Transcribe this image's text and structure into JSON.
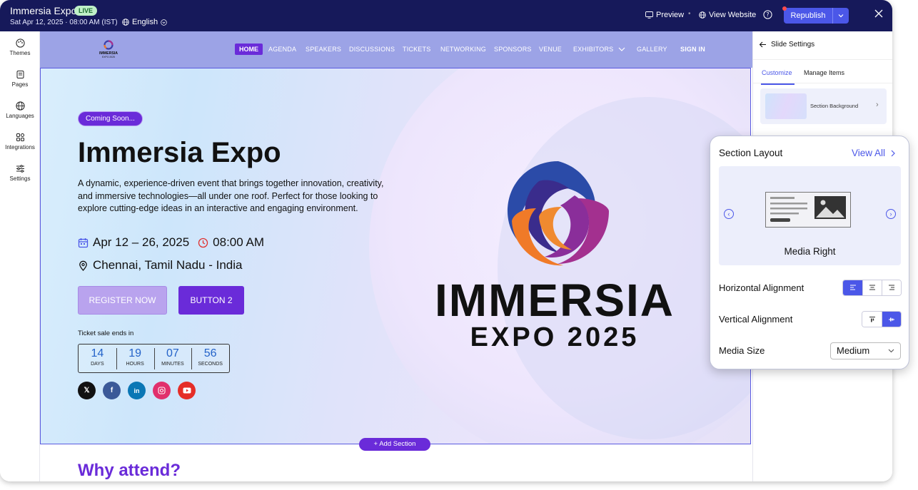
{
  "app": {
    "title": "Immersia Expo",
    "status": "LIVE",
    "date": "Sat Apr 12, 2025 · 08:00 AM (IST)",
    "language": "English",
    "actions": {
      "preview": "Preview",
      "view_website": "View Website",
      "republish": "Republish"
    }
  },
  "rail": [
    {
      "label": "Themes",
      "icon": "palette-icon"
    },
    {
      "label": "Pages",
      "icon": "pages-icon"
    },
    {
      "label": "Languages",
      "icon": "globe-icon"
    },
    {
      "label": "Integrations",
      "icon": "integrations-icon"
    },
    {
      "label": "Settings",
      "icon": "sliders-icon"
    }
  ],
  "site_nav": {
    "logo_text": "IMMERSIA",
    "logo_sub": "EXPO 2025",
    "items": [
      "HOME",
      "AGENDA",
      "SPEAKERS",
      "DISCUSSIONS",
      "TICKETS",
      "NETWORKING",
      "SPONSORS",
      "VENUE",
      "EXHIBITORS",
      "GALLERY",
      "SIGN IN"
    ]
  },
  "hero": {
    "badge": "Coming Soon...",
    "title": "Immersia Expo",
    "description": "A dynamic, experience-driven event that brings together innovation, creativity, and immersive technologies—all under one roof. Perfect for those looking to explore cutting-edge ideas in an interactive and engaging environment.",
    "dates": "Apr 12 – 26, 2025",
    "time": "08:00 AM",
    "location": "Chennai, Tamil Nadu - India",
    "register_button": "REGISTER NOW",
    "button2": "BUTTON 2",
    "ticket_label": "Ticket sale ends in",
    "countdown": [
      {
        "value": "14",
        "unit": "DAYS"
      },
      {
        "value": "19",
        "unit": "HOURS"
      },
      {
        "value": "07",
        "unit": "MINUTES"
      },
      {
        "value": "56",
        "unit": "SECONDS"
      }
    ],
    "brand_line1": "IMMERSIA",
    "brand_line2": "EXPO 2025"
  },
  "add_section": "+ Add Section",
  "next_section_title": "Why attend?",
  "panel": {
    "title": "Slide Settings",
    "tabs": [
      "Customize",
      "Manage Items"
    ],
    "background_label": "Section Background"
  },
  "layout_card": {
    "title": "Section Layout",
    "view_all": "View All",
    "layout_name": "Media Right",
    "horizontal_label": "Horizontal Alignment",
    "vertical_label": "Vertical Alignment",
    "media_size_label": "Media Size",
    "media_size_value": "Medium"
  },
  "colors": {
    "topbar": "#16195a",
    "accent": "#4b57e8",
    "brand_purple": "#6a2bd9",
    "countdown_blue": "#2463c9"
  }
}
